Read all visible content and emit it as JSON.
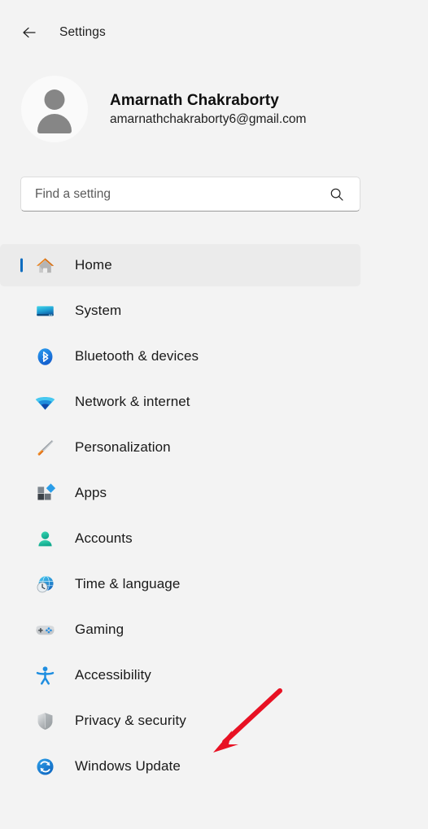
{
  "window": {
    "title": "Settings",
    "back_icon": "back-arrow-icon"
  },
  "account": {
    "name": "Amarnath Chakraborty",
    "email": "amarnathchakraborty6@gmail.com",
    "avatar_icon": "person-avatar-icon"
  },
  "search": {
    "placeholder": "Find a setting",
    "value": "",
    "icon": "search-icon"
  },
  "nav": {
    "items": [
      {
        "label": "Home",
        "icon": "home-icon",
        "selected": true
      },
      {
        "label": "System",
        "icon": "monitor-icon",
        "selected": false
      },
      {
        "label": "Bluetooth & devices",
        "icon": "bluetooth-icon",
        "selected": false
      },
      {
        "label": "Network & internet",
        "icon": "wifi-icon",
        "selected": false
      },
      {
        "label": "Personalization",
        "icon": "paintbrush-icon",
        "selected": false
      },
      {
        "label": "Apps",
        "icon": "apps-blocks-icon",
        "selected": false
      },
      {
        "label": "Accounts",
        "icon": "person-icon",
        "selected": false
      },
      {
        "label": "Time & language",
        "icon": "globe-clock-icon",
        "selected": false
      },
      {
        "label": "Gaming",
        "icon": "gamepad-icon",
        "selected": false
      },
      {
        "label": "Accessibility",
        "icon": "accessibility-icon",
        "selected": false
      },
      {
        "label": "Privacy & security",
        "icon": "shield-icon",
        "selected": false
      },
      {
        "label": "Windows Update",
        "icon": "sync-refresh-icon",
        "selected": false
      }
    ]
  },
  "annotation": {
    "type": "arrow",
    "color": "#e81123",
    "points_to": "Privacy & security"
  },
  "colors": {
    "background": "#f3f3f3",
    "selected_row": "#ebebeb",
    "accent": "#0b6cbf",
    "text": "#1a1a1a",
    "annotation": "#e81123"
  }
}
